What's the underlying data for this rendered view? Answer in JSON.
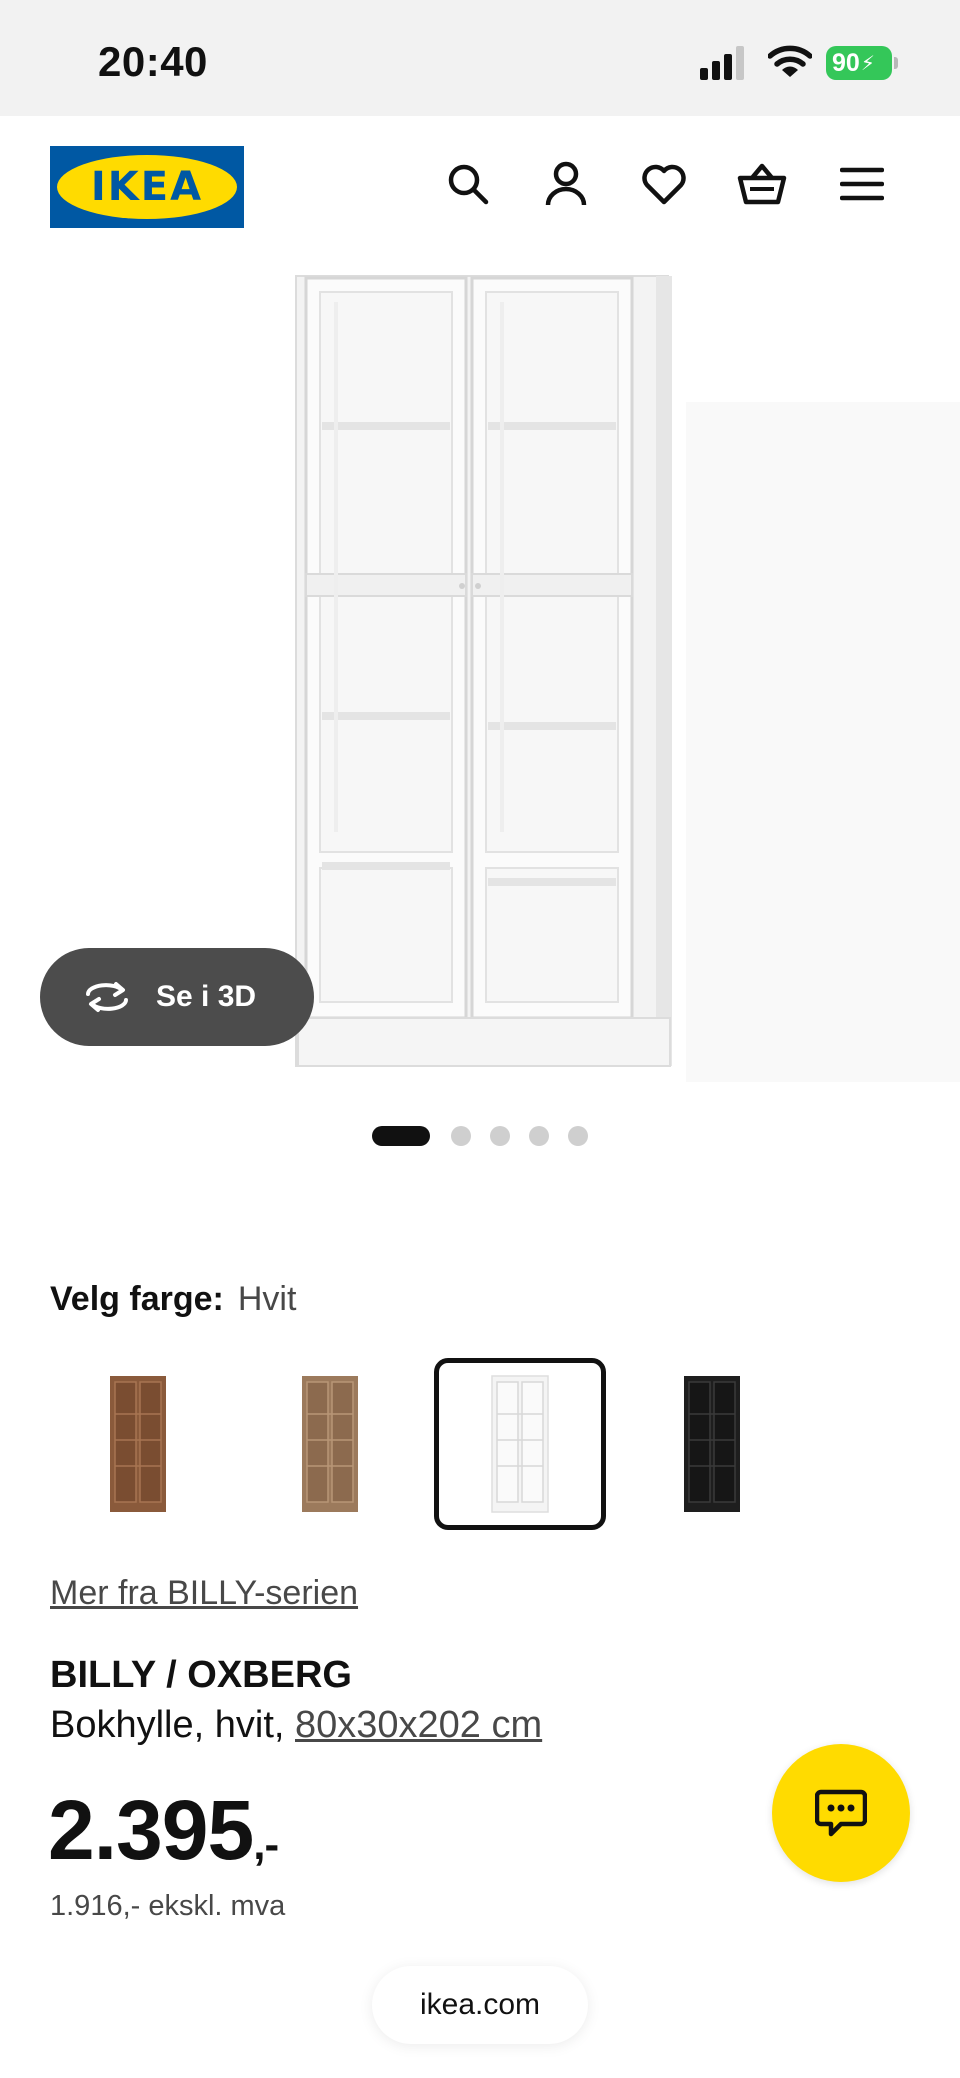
{
  "status_bar": {
    "time": "20:40",
    "battery": "90"
  },
  "header": {
    "logo_text": "IKEA",
    "icons": [
      "search-icon",
      "user-icon",
      "heart-icon",
      "basket-icon",
      "menu-icon"
    ]
  },
  "gallery": {
    "view_3d_label": "Se i 3D",
    "dot_count": 5,
    "active_dot": 0
  },
  "color_picker": {
    "label": "Velg farge:",
    "selected": "Hvit",
    "options": [
      {
        "color": "#8a5a3b"
      },
      {
        "color": "#9c7a5c"
      },
      {
        "color": "#f4f4f4",
        "selected": true
      },
      {
        "color": "#1e1e1e"
      }
    ]
  },
  "product": {
    "series_link": "Mer fra BILLY-serien",
    "name": "BILLY / OXBERG",
    "description": "Bokhylle, hvit, ",
    "dimensions": "80x30x202 cm",
    "price": "2.395",
    "price_suffix": ",-",
    "price_ex_vat": "1.916,- ekskl. mva"
  },
  "browser": {
    "url": "ikea.com"
  },
  "colors": {
    "ikea_blue": "#0058a3",
    "ikea_yellow": "#ffdb00"
  }
}
